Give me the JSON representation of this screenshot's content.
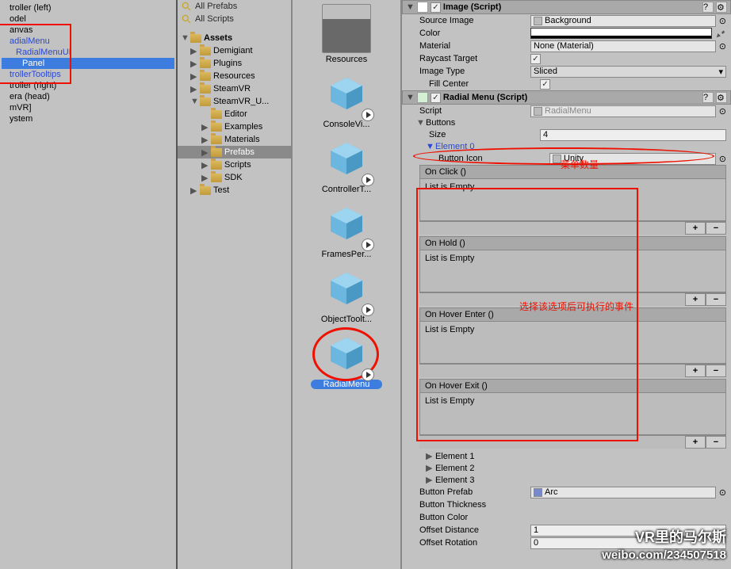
{
  "hierarchy": {
    "items": [
      {
        "label": "troller (left)",
        "blue": false,
        "indent": 0
      },
      {
        "label": "odel",
        "blue": false,
        "indent": 0
      },
      {
        "label": "anvas",
        "blue": false,
        "indent": 0
      },
      {
        "label": "adialMenu",
        "blue": true,
        "indent": 0
      },
      {
        "label": "RadialMenuUI",
        "blue": true,
        "indent": 1
      },
      {
        "label": "Panel",
        "blue": true,
        "indent": 2,
        "sel": true
      },
      {
        "label": "trollerTooltips",
        "blue": true,
        "indent": 0
      },
      {
        "label": "troller (right)",
        "blue": false,
        "indent": 0
      },
      {
        "label": "era (head)",
        "blue": false,
        "indent": 0
      },
      {
        "label": "mVR]",
        "blue": false,
        "indent": 0
      },
      {
        "label": "ystem",
        "blue": false,
        "indent": 0
      }
    ]
  },
  "project": {
    "search1": "All Prefabs",
    "search2": "All Scripts",
    "root": "Assets",
    "folders": [
      {
        "label": "Demigiant",
        "level": 1,
        "open": false
      },
      {
        "label": "Plugins",
        "level": 1,
        "open": false
      },
      {
        "label": "Resources",
        "level": 1,
        "open": false
      },
      {
        "label": "SteamVR",
        "level": 1,
        "open": false
      },
      {
        "label": "SteamVR_U...",
        "level": 1,
        "open": true
      },
      {
        "label": "Editor",
        "level": 2,
        "open": false
      },
      {
        "label": "Examples",
        "level": 2,
        "open": false
      },
      {
        "label": "Materials",
        "level": 2,
        "open": false
      },
      {
        "label": "Prefabs",
        "level": 2,
        "open": false,
        "sel": true
      },
      {
        "label": "Scripts",
        "level": 2,
        "open": false
      },
      {
        "label": "SDK",
        "level": 2,
        "open": false
      },
      {
        "label": "Test",
        "level": 1,
        "open": false
      }
    ]
  },
  "previews": [
    {
      "label": "Resources",
      "type": "folder"
    },
    {
      "label": "ConsoleVi...",
      "type": "prefab"
    },
    {
      "label": "ControllerT...",
      "type": "prefab"
    },
    {
      "label": "FramesPer...",
      "type": "prefab"
    },
    {
      "label": "ObjectToolt...",
      "type": "prefab"
    },
    {
      "label": "RadialMenu",
      "type": "prefab",
      "sel": true
    }
  ],
  "inspector": {
    "image": {
      "title": "Image (Script)",
      "sourceImage_label": "Source Image",
      "sourceImage_value": "Background",
      "color_label": "Color",
      "material_label": "Material",
      "material_value": "None (Material)",
      "raycast_label": "Raycast Target",
      "imageType_label": "Image Type",
      "imageType_value": "Sliced",
      "fillCenter_label": "Fill Center"
    },
    "radial": {
      "title": "Radial Menu (Script)",
      "script_label": "Script",
      "script_value": "RadialMenu",
      "buttons_label": "Buttons",
      "size_label": "Size",
      "size_value": "4",
      "element0_label": "Element 0",
      "buttonIcon_label": "Button Icon",
      "buttonIcon_value": "Unity",
      "events": [
        {
          "header": "On Click ()",
          "body": "List is Empty"
        },
        {
          "header": "On Hold ()",
          "body": "List is Empty"
        },
        {
          "header": "On Hover Enter ()",
          "body": "List is Empty"
        },
        {
          "header": "On Hover Exit ()",
          "body": "List is Empty"
        }
      ],
      "element1": "Element 1",
      "element2": "Element 2",
      "element3": "Element 3",
      "buttonPrefab_label": "Button Prefab",
      "buttonPrefab_value": "Arc",
      "buttonThickness_label": "Button Thickness",
      "buttonColor_label": "Button Color",
      "offsetDistance_label": "Offset Distance",
      "offsetDistance_value": "1",
      "offsetRotation_label": "Offset Rotation",
      "offsetRotation_value": "0"
    }
  },
  "annotations": {
    "menuCount": "菜单数量",
    "eventNote": "选择该选项后可执行的事件"
  },
  "watermark": {
    "line1": "VR里的马尔斯",
    "line2": "weibo.com/234507518"
  }
}
